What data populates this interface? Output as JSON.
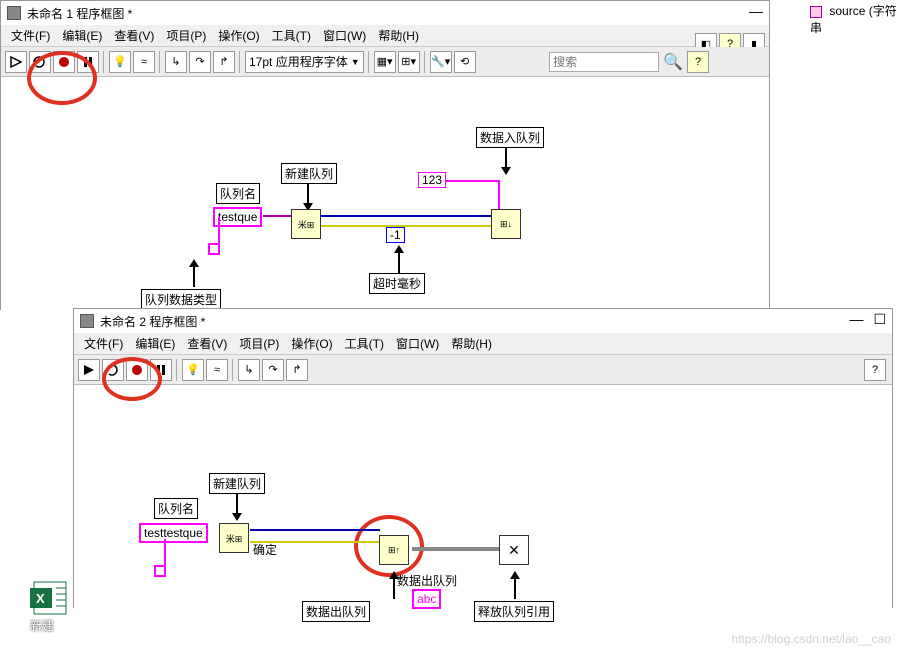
{
  "win1": {
    "title": "未命名 1 程序框图 *",
    "menus": [
      "文件(F)",
      "编辑(E)",
      "查看(V)",
      "项目(P)",
      "操作(O)",
      "工具(T)",
      "窗口(W)",
      "帮助(H)"
    ],
    "font": "17pt 应用程序字体",
    "search_ph": "搜索",
    "labels": {
      "queue_name": "队列名",
      "new_queue": "新建队列",
      "enqueue": "数据入队列",
      "timeout": "超时毫秒",
      "queue_type": "队列数据类型"
    },
    "consts": {
      "testque": "testque",
      "num123": "123",
      "neg1": "-1"
    }
  },
  "win2": {
    "title": "未命名 2 程序框图 *",
    "menus": [
      "文件(F)",
      "编辑(E)",
      "查看(V)",
      "项目(P)",
      "操作(O)",
      "工具(T)",
      "窗口(W)",
      "帮助(H)"
    ],
    "labels": {
      "queue_name": "队列名",
      "new_queue": "新建队列",
      "dequeue": "数据出队列",
      "release": "释放队列引用",
      "confirm": "确定"
    },
    "consts": {
      "testtestque": "testtestque",
      "abc": "abc"
    }
  },
  "source_tab": "source (字符串",
  "watermark": "https://blog.csdn.net/lao__cao",
  "excel_label": "新建"
}
